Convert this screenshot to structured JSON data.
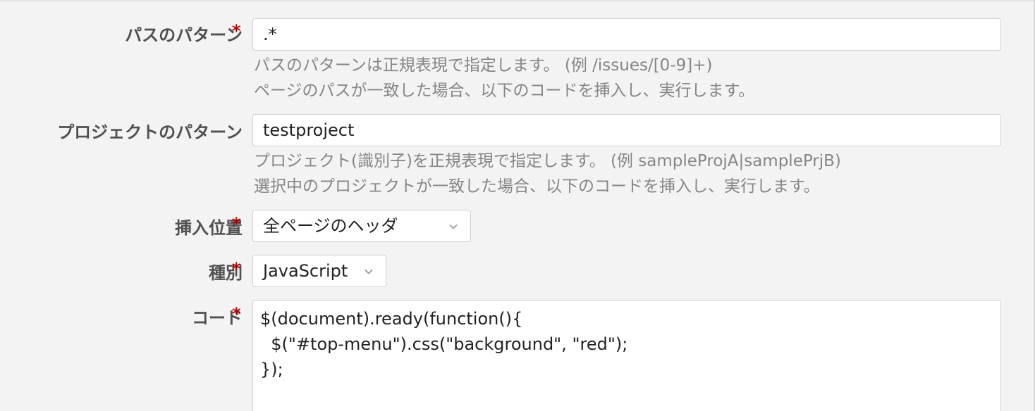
{
  "form": {
    "path_pattern": {
      "label": "パスのパターン",
      "required_mark": "*",
      "value": ".*",
      "hint_line1": "パスのパターンは正規表現で指定します。 (例 /issues/[0-9]+)",
      "hint_line2": "ページのパスが一致した場合、以下のコードを挿入し、実行します。"
    },
    "project_pattern": {
      "label": "プロジェクトのパターン",
      "value": "testproject",
      "hint_line1": "プロジェクト(識別子)を正規表現で指定します。 (例 sampleProjA|samplePrjB)",
      "hint_line2": "選択中のプロジェクトが一致した場合、以下のコードを挿入し、実行します。"
    },
    "insert_position": {
      "label": "挿入位置",
      "required_mark": "*",
      "selected": "全ページのヘッダ"
    },
    "type": {
      "label": "種別",
      "required_mark": "*",
      "selected": "JavaScript"
    },
    "code": {
      "label": "コード",
      "required_mark": "*",
      "lines": [
        "$(document).ready(function(){",
        "  $(\"#top-menu\").css(\"background\", \"red\");",
        "});"
      ]
    }
  },
  "colors": {
    "required": "#bb0000",
    "label": "#505050",
    "hint": "#868686",
    "background": "#f3f3f3"
  },
  "icons": {
    "select_arrow": "chevron-down-icon"
  }
}
